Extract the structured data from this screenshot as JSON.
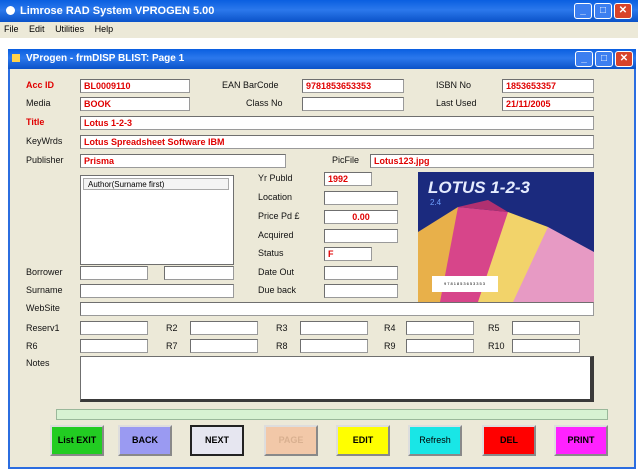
{
  "app": {
    "title": "Limrose RAD System    VPROGEN 5.00"
  },
  "menu": [
    "File",
    "Edit",
    "Utilities",
    "Help"
  ],
  "form": {
    "title": "VProgen - frmDISP    BLIST: Page 1"
  },
  "fields": {
    "acc_id": {
      "label": "Acc ID",
      "value": "BL0009110"
    },
    "ean": {
      "label": "EAN BarCode",
      "value": "9781853653353"
    },
    "isbn": {
      "label": "ISBN No",
      "value": "1853653357"
    },
    "media": {
      "label": "Media",
      "value": "BOOK"
    },
    "class_no": {
      "label": "Class No",
      "value": ""
    },
    "last_used": {
      "label": "Last Used",
      "value": "21/11/2005"
    },
    "title": {
      "label": "Title",
      "value": "Lotus 1-2-3"
    },
    "keywords": {
      "label": "KeyWrds",
      "value": "Lotus Spreadsheet Software IBM"
    },
    "publisher": {
      "label": "Publisher",
      "value": "Prisma"
    },
    "picfile": {
      "label": "PicFile",
      "value": "Lotus123.jpg"
    },
    "yr_publd": {
      "label": "Yr Publd",
      "value": "1992"
    },
    "location": {
      "label": "Location",
      "value": ""
    },
    "price_pd": {
      "label": "Price Pd £",
      "value": "0.00"
    },
    "acquired": {
      "label": "Acquired",
      "value": ""
    },
    "status": {
      "label": "Status",
      "value": "F"
    },
    "date_out": {
      "label": "Date Out",
      "value": ""
    },
    "due_back": {
      "label": "Due back",
      "value": ""
    },
    "borrower": {
      "label": "Borrower"
    },
    "surname": {
      "label": "Surname"
    },
    "website": {
      "label": "WebSite"
    },
    "reserv1": {
      "label": "Reserv1"
    },
    "r2": {
      "label": "R2"
    },
    "r3": {
      "label": "R3"
    },
    "r4": {
      "label": "R4"
    },
    "r5": {
      "label": "R5"
    },
    "r6": {
      "label": "R6"
    },
    "r7": {
      "label": "R7"
    },
    "r8": {
      "label": "R8"
    },
    "r9": {
      "label": "R9"
    },
    "r10": {
      "label": "R10"
    },
    "notes": {
      "label": "Notes"
    }
  },
  "author_list": {
    "header": "Author(Surname first)"
  },
  "cover": {
    "title": "LOTUS 1-2-3",
    "version": "2.4",
    "barcode_text": "9781853653353"
  },
  "buttons": [
    {
      "id": "list-exit",
      "label": "List EXIT",
      "bg": "#22cc22",
      "color": "#000000"
    },
    {
      "id": "back",
      "label": "BACK",
      "bg": "#9a9af2",
      "color": "#000000"
    },
    {
      "id": "next",
      "label": "NEXT",
      "bg": "#e6e6f0",
      "color": "#000000"
    },
    {
      "id": "page",
      "label": "PAGE",
      "bg": "#f2c8a8",
      "color": "#d9b090"
    },
    {
      "id": "edit",
      "label": "EDIT",
      "bg": "#ffff00",
      "color": "#000000"
    },
    {
      "id": "refresh",
      "label": "Refresh",
      "bg": "#19e6e6",
      "color": "#000000"
    },
    {
      "id": "del",
      "label": "DEL",
      "bg": "#ff0000",
      "color": "#000000"
    },
    {
      "id": "print",
      "label": "PRINT",
      "bg": "#ff22ff",
      "color": "#000000"
    }
  ]
}
